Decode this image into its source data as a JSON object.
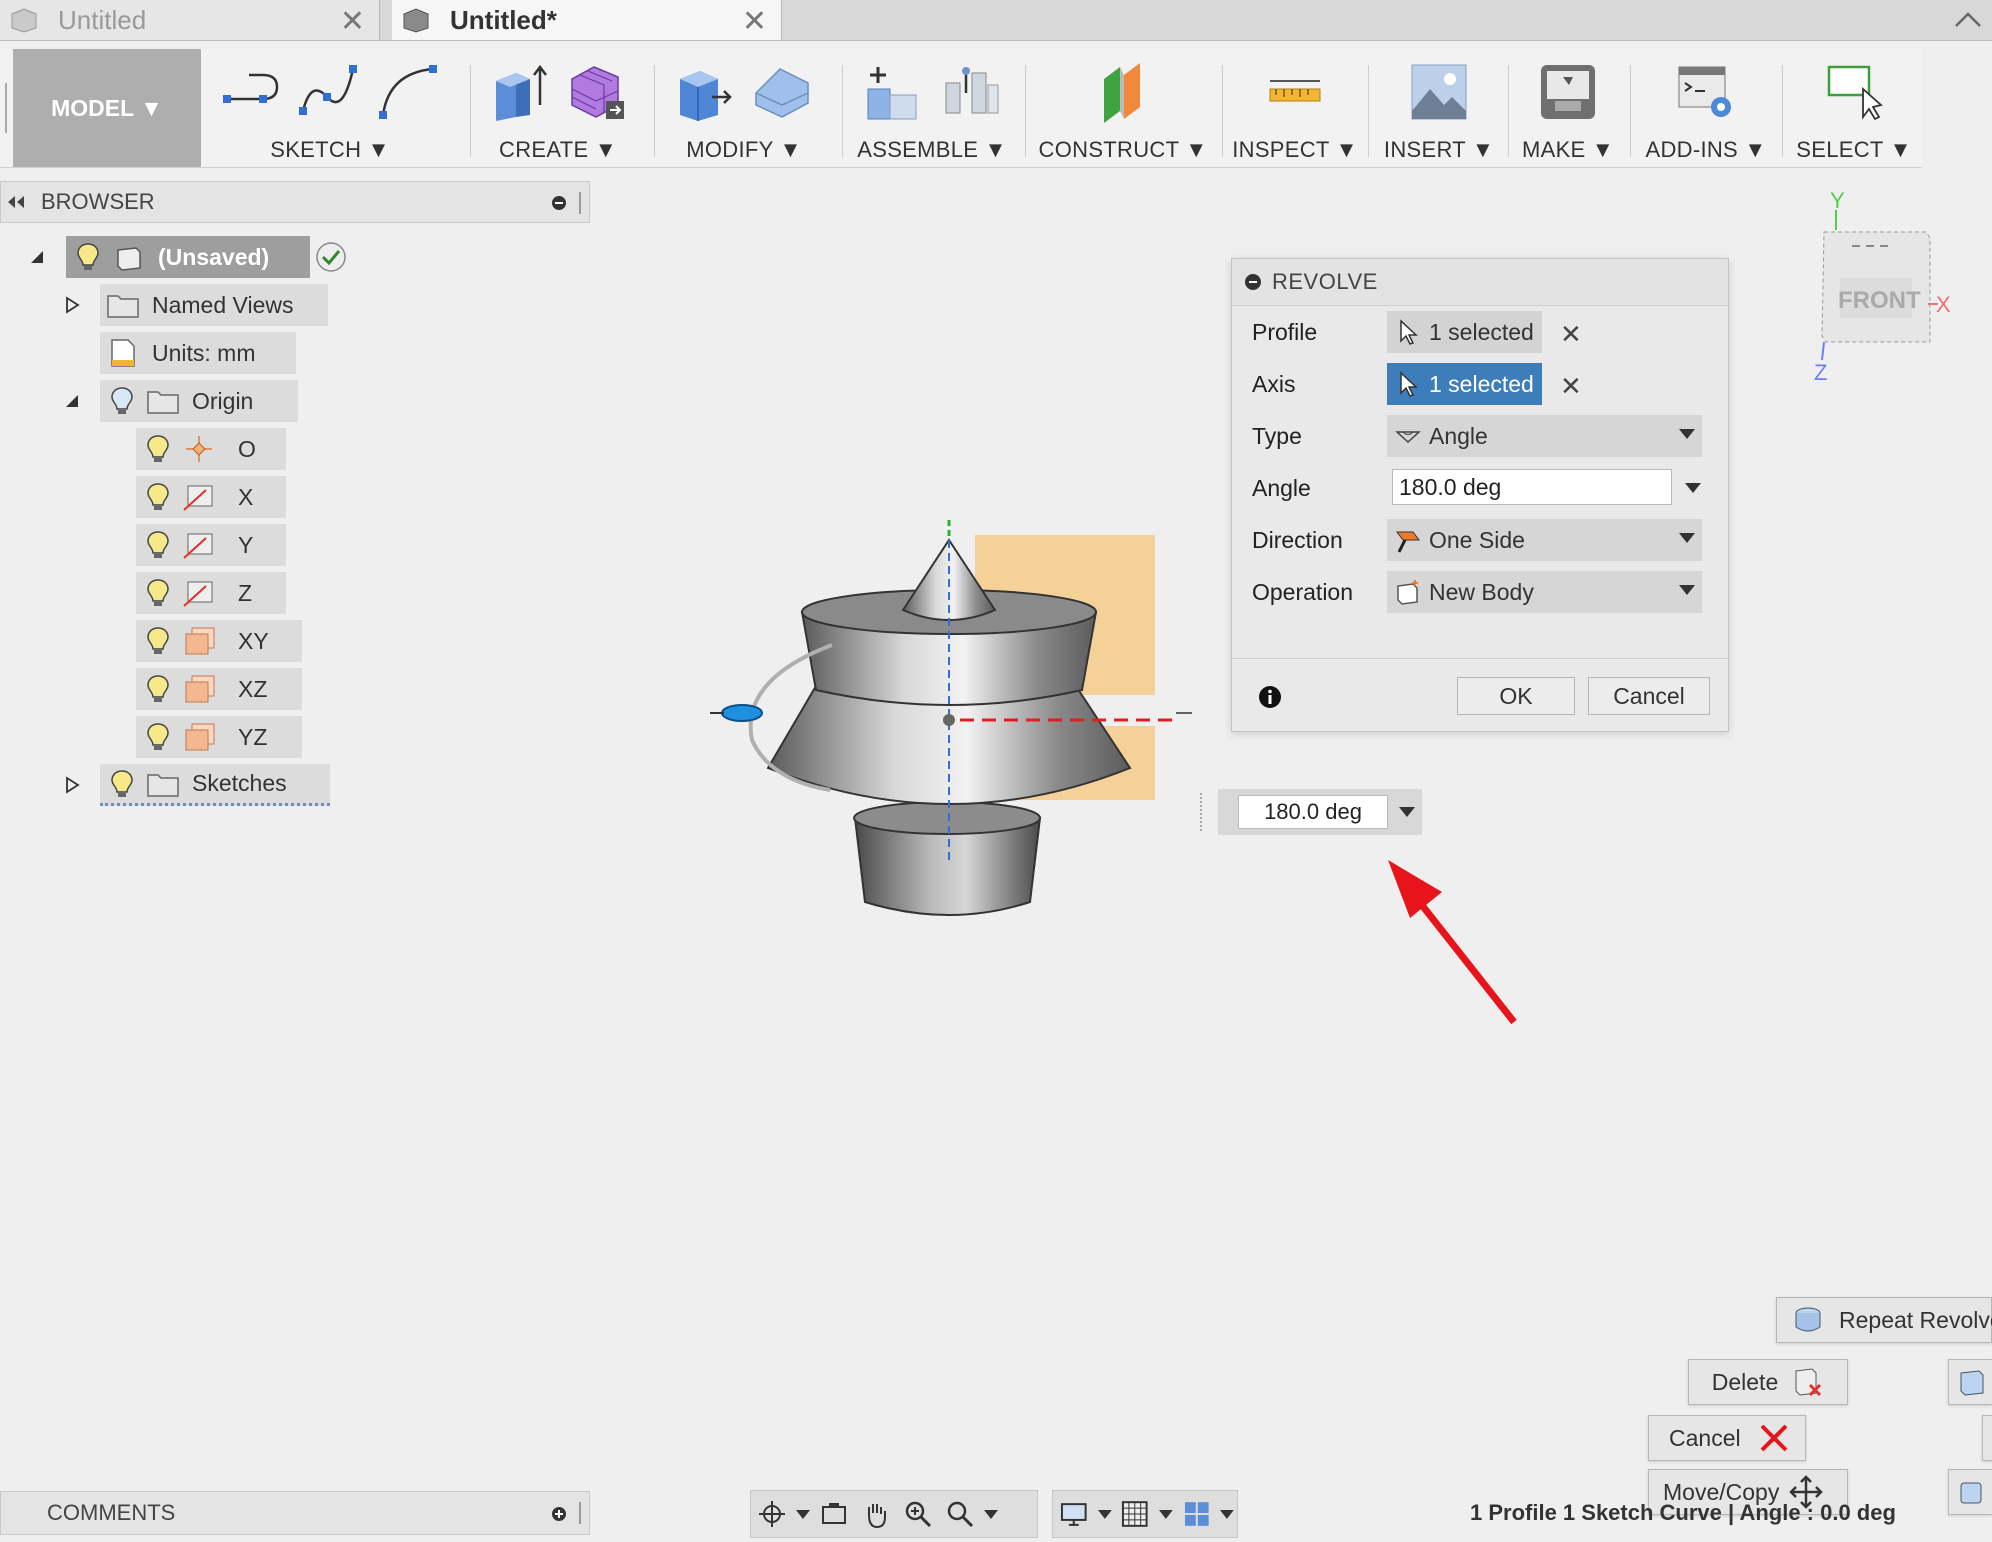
{
  "tabs": [
    {
      "label": "Untitled",
      "active": false
    },
    {
      "label": "Untitled*",
      "active": true
    }
  ],
  "toolbar": {
    "model_label": "MODEL ▼",
    "groups": [
      {
        "label": "SKETCH ▼"
      },
      {
        "label": "CREATE ▼"
      },
      {
        "label": "MODIFY ▼"
      },
      {
        "label": "ASSEMBLE ▼"
      },
      {
        "label": "CONSTRUCT ▼"
      },
      {
        "label": "INSPECT ▼"
      },
      {
        "label": "INSERT ▼"
      },
      {
        "label": "MAKE ▼"
      },
      {
        "label": "ADD-INS ▼"
      },
      {
        "label": "SELECT ▼"
      }
    ]
  },
  "browser": {
    "title": "BROWSER",
    "root": "(Unsaved)",
    "named_views": "Named Views",
    "units": "Units: mm",
    "origin": "Origin",
    "origin_items": [
      "O",
      "X",
      "Y",
      "Z",
      "XY",
      "XZ",
      "YZ"
    ],
    "sketches": "Sketches"
  },
  "dialog": {
    "title": "REVOLVE",
    "profile_label": "Profile",
    "profile_value": "1 selected",
    "axis_label": "Axis",
    "axis_value": "1 selected",
    "type_label": "Type",
    "type_value": "Angle",
    "angle_label": "Angle",
    "angle_value": "180.0 deg",
    "direction_label": "Direction",
    "direction_value": "One Side",
    "operation_label": "Operation",
    "operation_value": "New Body",
    "ok": "OK",
    "cancel": "Cancel"
  },
  "float_angle": "180.0 deg",
  "viewcube": {
    "face": "FRONT",
    "x": "X",
    "y": "Y",
    "z": "Z"
  },
  "context_menu": {
    "repeat": "Repeat Revolve",
    "delete": "Delete",
    "cancel": "Cancel",
    "move_copy": "Move/Copy"
  },
  "comments": "COMMENTS",
  "status": "1 Profile 1 Sketch Curve | Angle : 0.0 deg",
  "colors": {
    "accent": "#3d7eba",
    "annotation_arrow": "#e8141b",
    "profile_highlight": "#f7c77e"
  }
}
